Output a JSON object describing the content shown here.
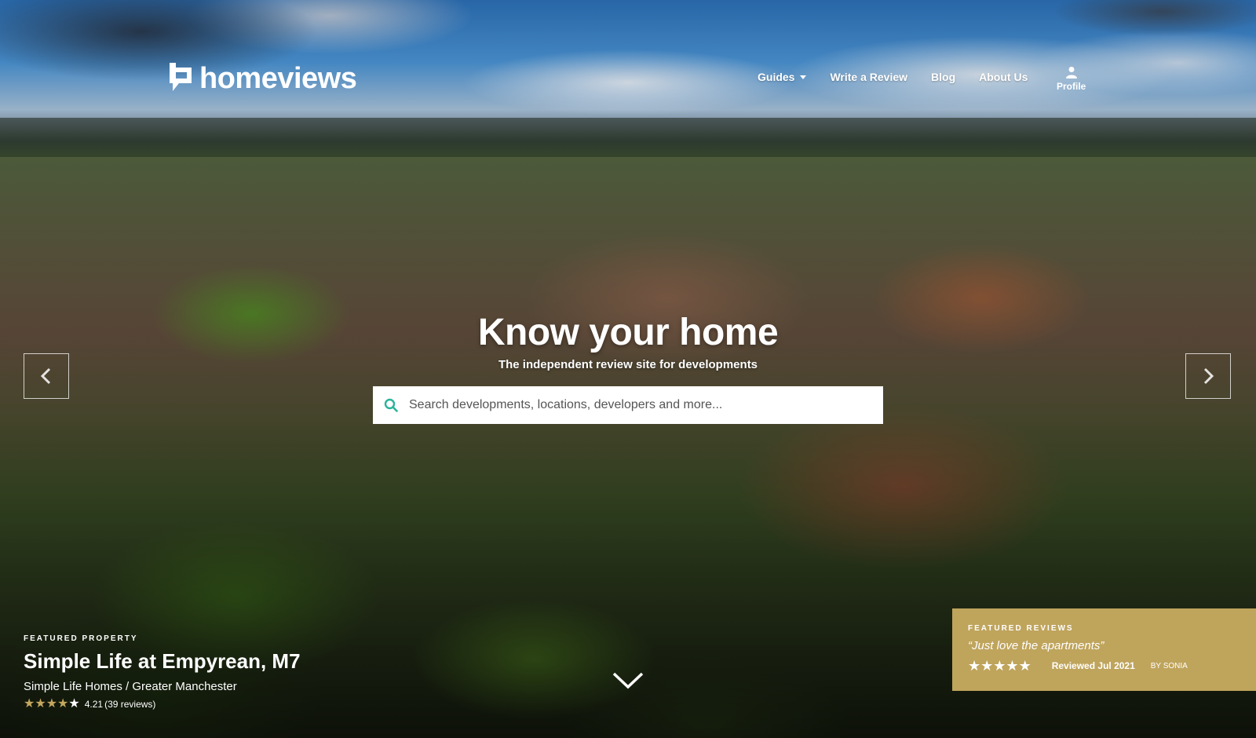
{
  "brand": {
    "name": "homeviews"
  },
  "nav": {
    "items": [
      {
        "label": "Guides",
        "has_dropdown": true
      },
      {
        "label": "Write a Review"
      },
      {
        "label": "Blog"
      },
      {
        "label": "About Us"
      }
    ],
    "profile_label": "Profile",
    "profile_icon": "user-icon"
  },
  "hero": {
    "title": "Know your home",
    "subtitle": "The independent review site for developments",
    "search": {
      "placeholder": "Search developments, locations, developers and more...",
      "value": "",
      "icon": "search-icon",
      "icon_color": "#2bb39a"
    },
    "prev_icon": "chevron-left-icon",
    "next_icon": "chevron-right-icon",
    "scroll_icon": "chevron-down-icon"
  },
  "featured_property": {
    "label": "FEATURED PROPERTY",
    "title": "Simple Life at Empyrean, M7",
    "subtitle": "Simple Life Homes / Greater Manchester",
    "rating": "4.21",
    "rating_value": 4.21,
    "reviews": "(39 reviews)",
    "star_color": "#c4a75e"
  },
  "featured_review": {
    "label": "FEATURED REVIEWS",
    "quote": "“Just love the apartments”",
    "stars": 5,
    "date": "Reviewed Jul 2021",
    "author": "BY SONIA",
    "background": "#bfa45c"
  }
}
